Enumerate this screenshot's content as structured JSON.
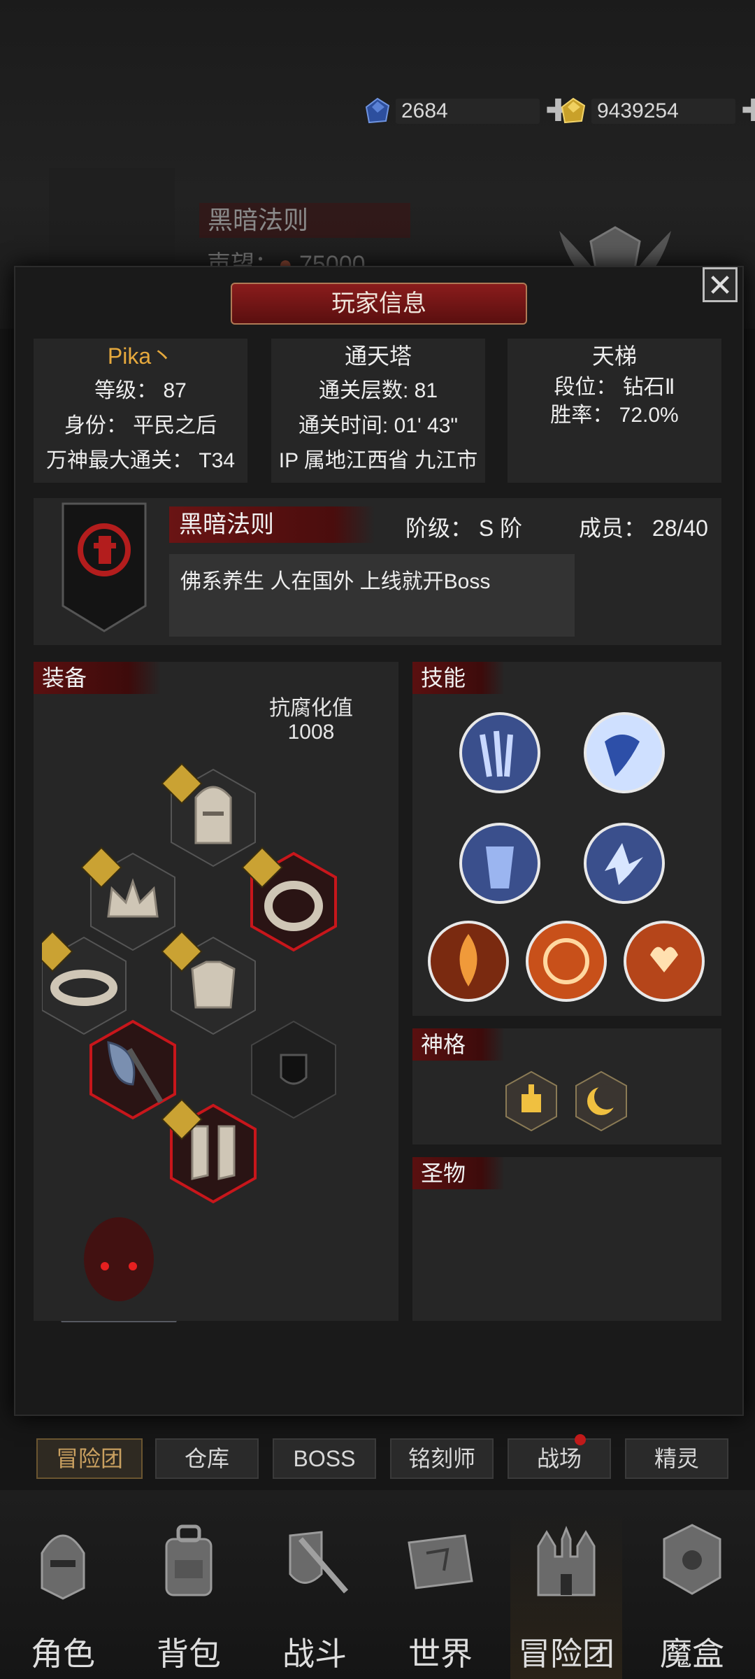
{
  "currency": {
    "gems": "2684",
    "gold": "9439254"
  },
  "background": {
    "guild_name": "黑暗法则",
    "reputation_label": "声望：",
    "reputation_value": "75000"
  },
  "modal": {
    "title": "玩家信息",
    "player": {
      "name": "Pika丶",
      "level": "等级：  87",
      "identity": "身份：  平民之后",
      "max_clear": "万神最大通关：  T34"
    },
    "tower": {
      "title": "通天塔",
      "floors": "通关层数: 81",
      "time": "通关时间: 01' 43\"",
      "ip": "IP 属地江西省 九江市"
    },
    "ladder": {
      "title": "天梯",
      "rank": "段位：  钻石Ⅱ",
      "win_rate": "胜率：  72.0%"
    },
    "guild": {
      "name": "黑暗法则",
      "tier": "阶级：  S 阶",
      "members": "成员：  28/40",
      "description": "佛系养生 人在国外 上线就开Boss"
    },
    "equipment": {
      "title": "装备",
      "corruption_label": "抗腐化值",
      "corruption_value": "1008"
    },
    "skills": {
      "title": "技能"
    },
    "divinity": {
      "title": "神格"
    },
    "relics": {
      "title": "圣物"
    }
  },
  "bottom_tabs": [
    "冒险团",
    "仓库",
    "BOSS",
    "铭刻师",
    "战场",
    "精灵"
  ],
  "nav": [
    "角色",
    "背包",
    "战斗",
    "世界",
    "冒险团",
    "魔盒"
  ],
  "colors": {
    "accent_red": "#8a1c1c",
    "gold_text": "#e6a93d",
    "skill_blue": "#3d5fb0",
    "skill_fire": "#c0521c"
  }
}
